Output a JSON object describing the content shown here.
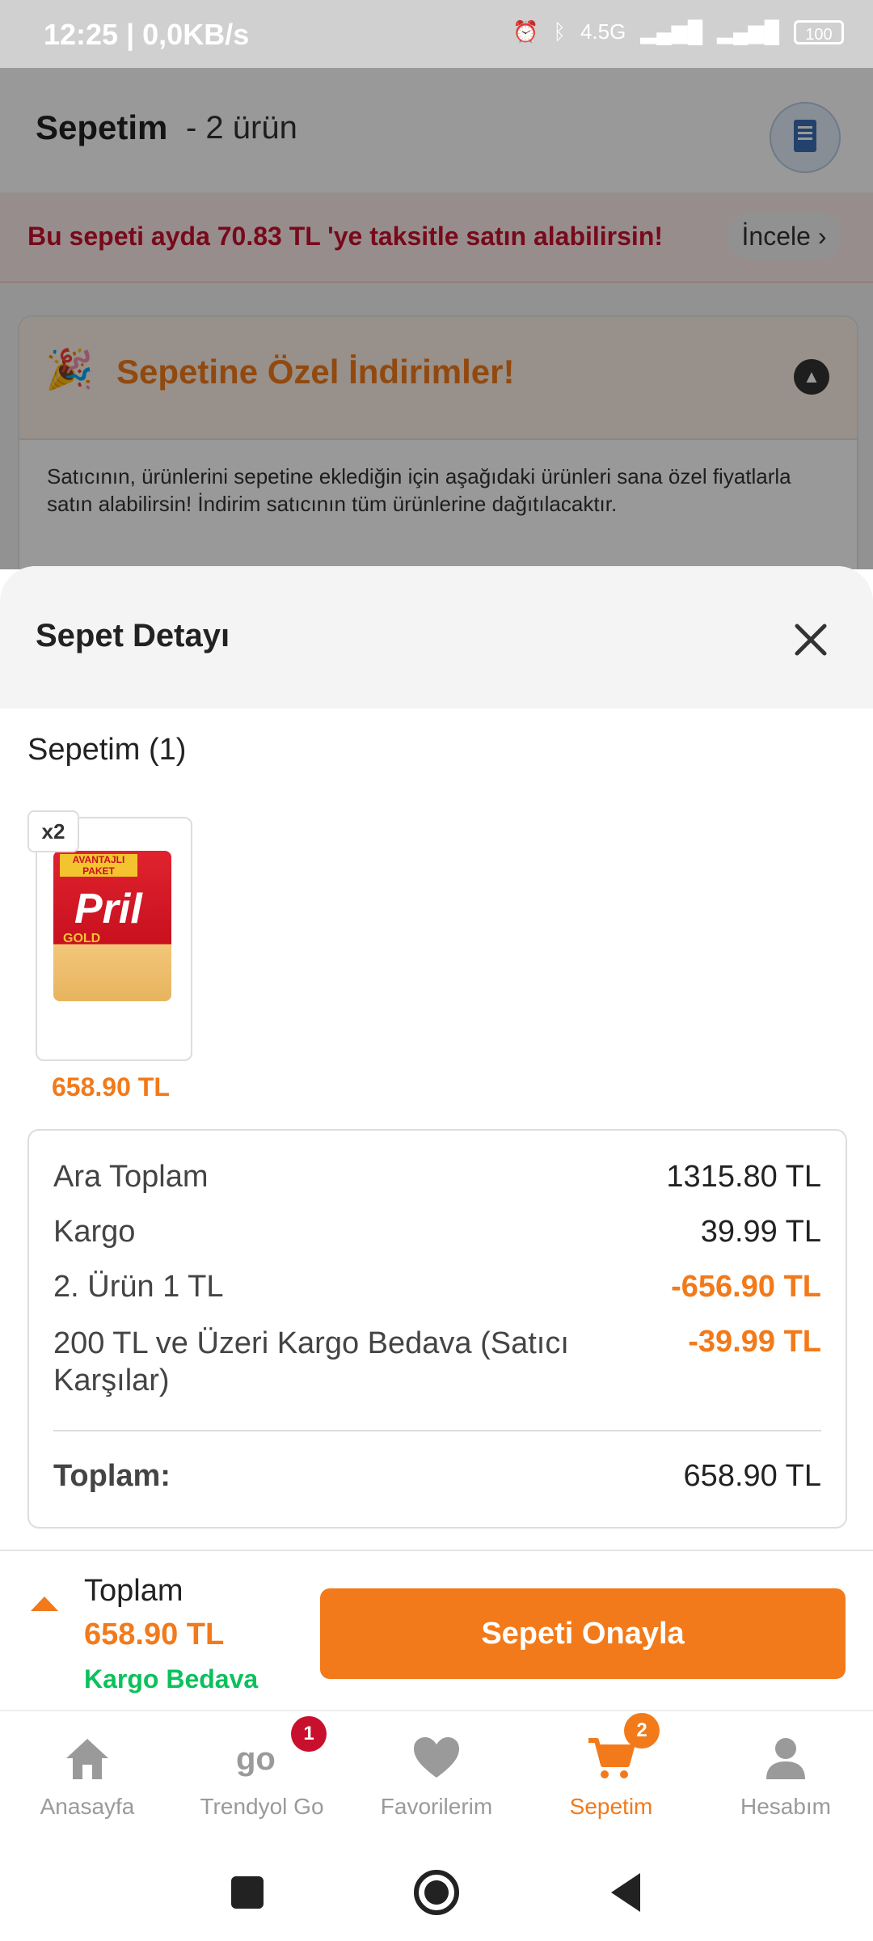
{
  "status_bar": {
    "time": "12:25 | 0,0KB/s",
    "network": "4.5G",
    "battery": "100"
  },
  "header": {
    "title": "Sepetim",
    "count": "- 2 ürün"
  },
  "installment": {
    "text": "Bu sepeti ayda 70.83 TL 'ye taksitle satın alabilirsin!",
    "link": "İncele"
  },
  "discount_section": {
    "title": "Sepetine Özel İndirimler!",
    "description": "Satıcının, ürünlerini sepetine eklediğin için aşağıdaki ürünleri sana özel fiyatlarla satın alabilirsin! İndirim satıcının tüm ürünlerine dağıtılacaktır."
  },
  "sheet": {
    "title": "Sepet Detayı",
    "cart_label": "Sepetim (1)",
    "product": {
      "quantity": "x2",
      "brand": "Pril",
      "tag": "AVANTAJLI PAKET",
      "variant": "GOLD",
      "price": "658.90 TL"
    },
    "summary": [
      {
        "label": "Ara Toplam",
        "value": "1315.80 TL",
        "discount": false
      },
      {
        "label": "Kargo",
        "value": "39.99 TL",
        "discount": false
      },
      {
        "label": "2. Ürün 1 TL",
        "value": "-656.90 TL",
        "discount": true
      },
      {
        "label": "200 TL ve Üzeri Kargo Bedava (Satıcı Karşılar)",
        "value": "-39.99 TL",
        "discount": true
      }
    ],
    "total_label": "Toplam:",
    "total_value": "658.90 TL"
  },
  "action_bar": {
    "total_label": "Toplam",
    "total_value": "658.90 TL",
    "shipping": "Kargo Bedava",
    "confirm_button": "Sepeti Onayla"
  },
  "bottom_nav": {
    "items": [
      {
        "label": "Anasayfa",
        "icon": "home-icon"
      },
      {
        "label": "Trendyol Go",
        "icon": "trendyol-go-icon",
        "badge": "1"
      },
      {
        "label": "Favorilerim",
        "icon": "heart-icon"
      },
      {
        "label": "Sepetim",
        "icon": "cart-icon",
        "badge": "2",
        "active": true
      },
      {
        "label": "Hesabım",
        "icon": "user-icon"
      }
    ]
  },
  "colors": {
    "brand": "#f27a1a",
    "success": "#0bc15c",
    "alert": "#c8102e",
    "badge_red": "#c8102e"
  }
}
